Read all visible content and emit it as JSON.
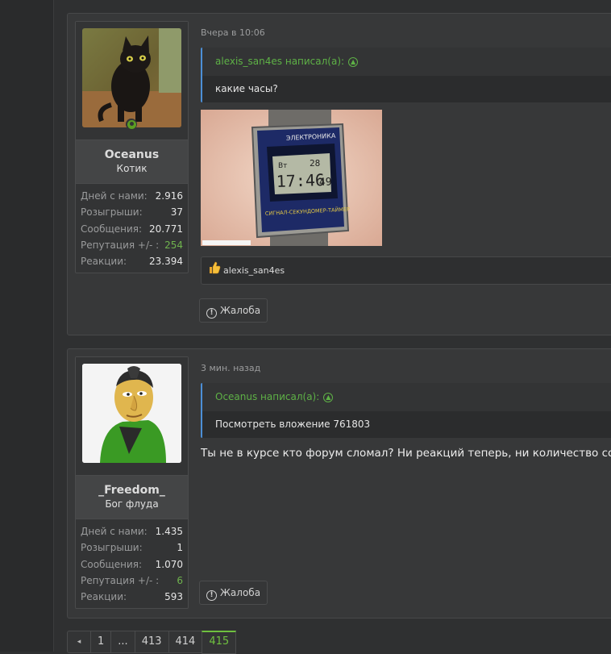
{
  "posts": [
    {
      "user": {
        "name": "Oceanus",
        "title": "Котик",
        "stats": [
          {
            "label": "Дней с нами:",
            "value": "2.916"
          },
          {
            "label": "Розыгрыши:",
            "value": "37"
          },
          {
            "label": "Сообщения:",
            "value": "20.771"
          },
          {
            "label": "Репутация +/- :",
            "value": "254"
          },
          {
            "label": "Реакции:",
            "value": "23.394"
          }
        ]
      },
      "date": "Вчера в 10:06",
      "quote": {
        "author": "alexis_san4es написал(а):",
        "text": "какие часы?"
      },
      "reaction_user": "alexis_san4es",
      "report_label": "Жалоба",
      "watch_text": {
        "brand": "ЭЛЕКТРОНИКА",
        "time": "17:46",
        "sec": "49",
        "date": "28",
        "day": "Вт",
        "band": "СИГНАЛ-СЕКУНДОМЕР-ТАЙМЕР"
      }
    },
    {
      "user": {
        "name": "_Freedom_",
        "title": "Бог флуда",
        "stats": [
          {
            "label": "Дней с нами:",
            "value": "1.435"
          },
          {
            "label": "Розыгрыши:",
            "value": "1"
          },
          {
            "label": "Сообщения:",
            "value": "1.070"
          },
          {
            "label": "Репутация +/- :",
            "value": "6"
          },
          {
            "label": "Реакции:",
            "value": "593"
          }
        ]
      },
      "date": "3 мин. назад",
      "quote": {
        "author": "Oceanus написал(а):",
        "text": "Посмотреть вложение 761803"
      },
      "text": "Ты не в курсе кто форум сломал? Ни реакций теперь, ни количество сообщ",
      "report_label": "Жалоба"
    }
  ],
  "pagination": {
    "prev": "◂",
    "pages": [
      "1",
      "...",
      "413",
      "414",
      "415"
    ],
    "current": "415"
  },
  "colors": {
    "accent_green": "#6fb34e",
    "quote_border": "#4c8fd6",
    "background": "#2f3031"
  }
}
